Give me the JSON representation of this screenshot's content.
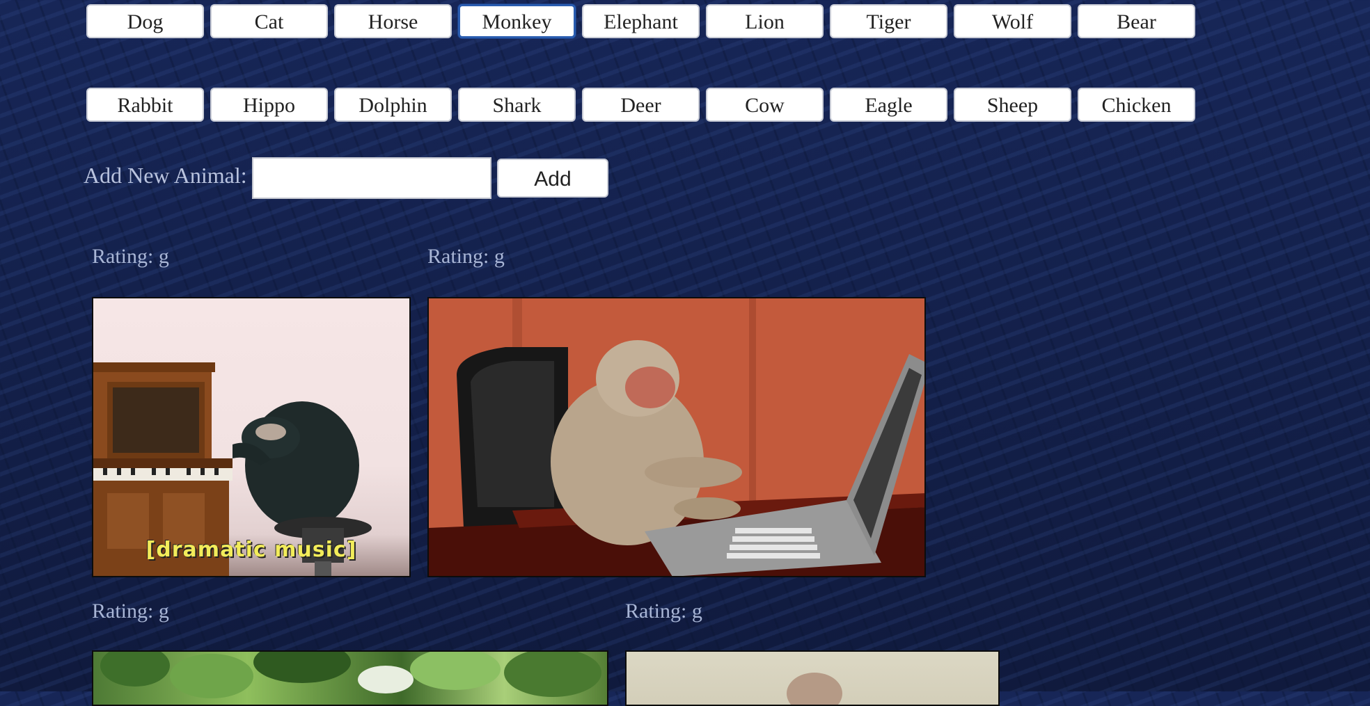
{
  "animals_row1": [
    "Dog",
    "Cat",
    "Horse",
    "Monkey",
    "Elephant",
    "Lion",
    "Tiger",
    "Wolf",
    "Bear"
  ],
  "animals_row2": [
    "Rabbit",
    "Hippo",
    "Dolphin",
    "Shark",
    "Deer",
    "Cow",
    "Eagle",
    "Sheep",
    "Chicken"
  ],
  "selected_animal": "Monkey",
  "add_form": {
    "label": "Add New Animal:",
    "input_value": "",
    "button_label": "Add"
  },
  "results": [
    {
      "rating": "Rating: g",
      "caption": "[dramatic music]"
    },
    {
      "rating": "Rating: g",
      "caption": ""
    },
    {
      "rating": "Rating: g",
      "caption": ""
    },
    {
      "rating": "Rating: g",
      "caption": ""
    }
  ],
  "colors": {
    "background": "#14204a",
    "button_bg": "#ffffff",
    "selected_border": "#2a5db0",
    "label_text": "#b9c3de"
  }
}
